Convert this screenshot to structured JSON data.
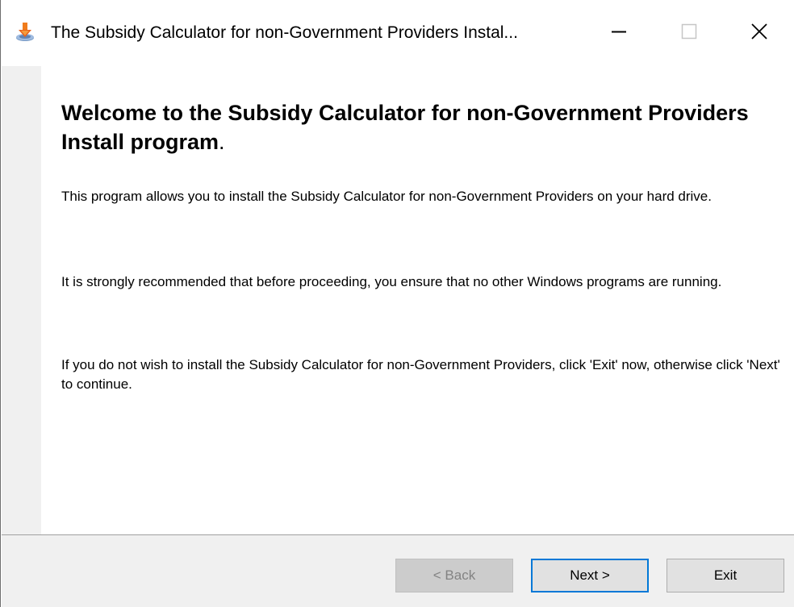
{
  "window": {
    "title": "The Subsidy Calculator for non-Government Providers Instal...",
    "icon": "installer-download-icon",
    "controls": {
      "minimize": "minimize-icon",
      "maximize": "maximize-icon",
      "close": "close-icon"
    }
  },
  "main": {
    "heading": "Welcome to the Subsidy Calculator for non-Government Providers Install program",
    "heading_suffix": ".",
    "paragraphs": [
      "This program allows you to install the Subsidy Calculator for non-Government Providers on your hard drive.",
      "It is strongly recommended that before proceeding, you ensure that no other Windows programs are running.",
      "If you do not wish to install the Subsidy Calculator for non-Government Providers, click 'Exit' now, otherwise click 'Next' to continue."
    ]
  },
  "footer": {
    "back_label": "< Back",
    "next_label": "Next >",
    "exit_label": "Exit"
  },
  "colors": {
    "focus_border": "#0078d7",
    "panel_background": "#f0f0f0",
    "disabled_text": "#838383"
  }
}
